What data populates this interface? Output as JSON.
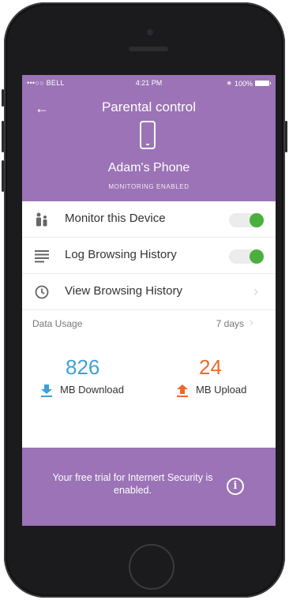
{
  "status_bar": {
    "carrier": "•••○○ BELL",
    "time": "4:21 PM",
    "battery": "100%"
  },
  "header": {
    "title": "Parental control",
    "device_name": "Adam's Phone",
    "monitoring_status": "MONITORING ENABLED"
  },
  "settings": [
    {
      "label": "Monitor this Device",
      "control": "toggle",
      "on": true,
      "icon": "family-icon"
    },
    {
      "label": "Log Browsing History",
      "control": "toggle",
      "on": true,
      "icon": "list-icon"
    },
    {
      "label": "View Browsing History",
      "control": "chevron",
      "icon": "clock-icon"
    }
  ],
  "data_usage": {
    "label": "Data Usage",
    "period": "7 days",
    "download": {
      "value": "826",
      "unit_label": "MB Download",
      "color": "#3ea0d9"
    },
    "upload": {
      "value": "24",
      "unit_label": "MB Upload",
      "color": "#ea6a2d"
    }
  },
  "footer": {
    "message": "Your free trial for Internert Security is enabled."
  },
  "colors": {
    "accent": "#9b73b6",
    "toggle_on": "#4ab03d"
  }
}
